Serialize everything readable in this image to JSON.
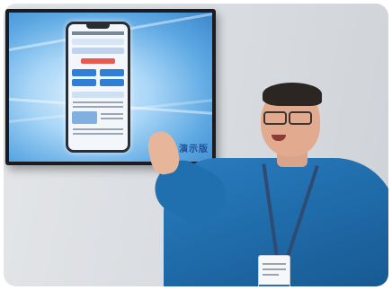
{
  "screen": {
    "caption": "",
    "demo_label": "演示版"
  }
}
